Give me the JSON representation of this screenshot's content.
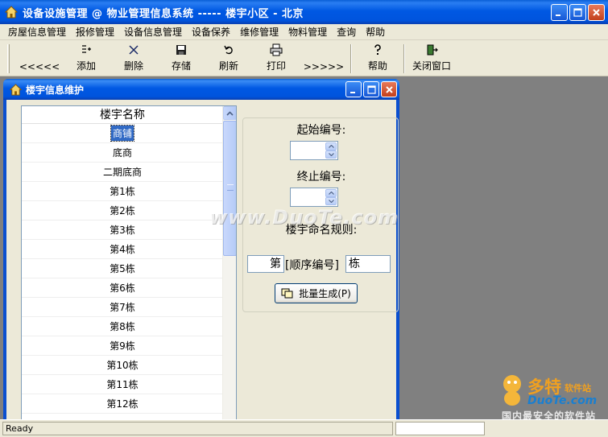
{
  "window": {
    "title": "设备设施管理 @ 物业管理信息系统 ----- 楼宇小区 - 北京"
  },
  "menu": [
    "房屋信息管理",
    "报修管理",
    "设备信息管理",
    "设备保养",
    "维修管理",
    "物料管理",
    "查询",
    "帮助"
  ],
  "toolbar": {
    "prev": "<<<<<",
    "add": "添加",
    "delete": "删除",
    "save": "存储",
    "refresh": "刷新",
    "print": "打印",
    "next": ">>>>>",
    "help": "帮助",
    "close_window": "关闭窗口"
  },
  "child_window": {
    "title": "楼宇信息维护"
  },
  "list": {
    "header": "楼宇名称",
    "selected_index": 0,
    "items": [
      "商铺",
      "底商",
      "二期底商",
      "第1栋",
      "第2栋",
      "第3栋",
      "第4栋",
      "第5栋",
      "第6栋",
      "第7栋",
      "第8栋",
      "第9栋",
      "第10栋",
      "第11栋",
      "第12栋"
    ]
  },
  "form": {
    "start_label": "起始编号:",
    "start_value": "",
    "end_label": "终止编号:",
    "end_value": "",
    "rule_label": "楼宇命名规则:",
    "prefix_value": "第",
    "sequence_label": "[顺序编号]",
    "suffix_value": "栋",
    "generate_button": "批量生成(P)"
  },
  "watermark": {
    "text": "www.DuoTe.com",
    "logo_top": "多特",
    "logo_small": "软件站",
    "logo_mid": "DuoTe.com",
    "logo_bottom": "国内最安全的软件站"
  },
  "status": {
    "text": "Ready"
  }
}
